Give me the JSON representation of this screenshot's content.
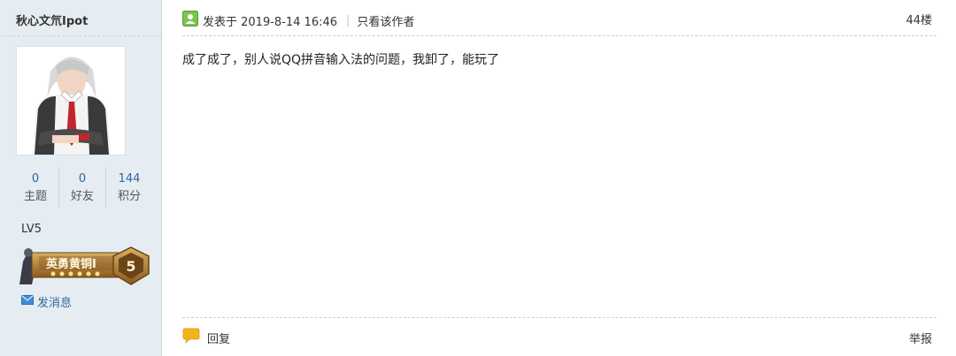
{
  "author": {
    "name": "秋心文氘Ipot"
  },
  "stats": [
    {
      "value": "0",
      "label": "主题"
    },
    {
      "value": "0",
      "label": "好友"
    },
    {
      "value": "144",
      "label": "积分"
    }
  ],
  "level": "LV5",
  "badge": {
    "text": "英勇黄铜I",
    "number": "5"
  },
  "send_message": "发消息",
  "post": {
    "posted_on": "发表于 2019-8-14 16:46",
    "author_only": "只看该作者",
    "floor": "44楼",
    "content": "成了成了，别人说QQ拼音输入法的问题，我卸了，能玩了"
  },
  "footer": {
    "reply": "回复",
    "report": "举报"
  },
  "colors": {
    "sidebar_bg": "#e5edf2",
    "link_blue": "#336699",
    "badge_gold": "#b88a3c"
  }
}
